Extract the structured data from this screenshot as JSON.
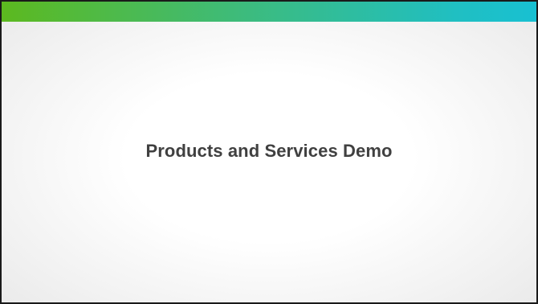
{
  "slide": {
    "title": "Products and Services Demo",
    "colors": {
      "band_start": "#5cb91f",
      "band_end": "#18c0d2",
      "title_text": "#404040",
      "border": "#1a1a1a"
    }
  }
}
